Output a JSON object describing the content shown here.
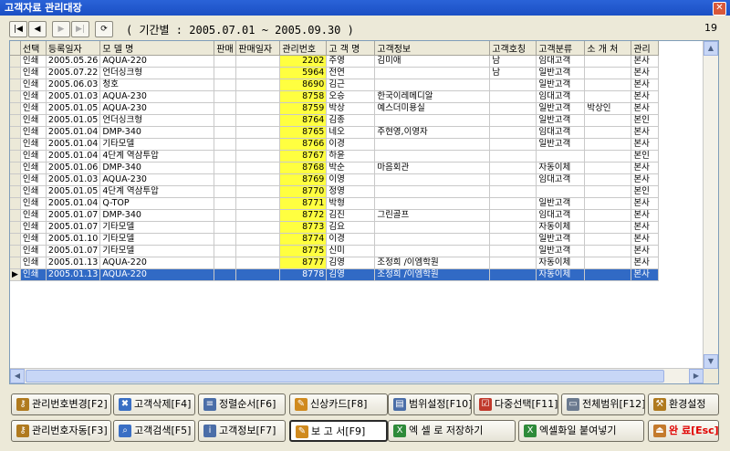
{
  "window": {
    "title": "고객자료 관리대장",
    "close_glyph": "✕"
  },
  "toolbar": {
    "nav": [
      "|◀",
      "◀",
      "▶",
      "▶|",
      "⟳"
    ],
    "period": "( 기간별 : 2005.07.01 ~ 2005.09.30 )",
    "count": "19"
  },
  "table": {
    "columns": [
      "선택",
      "등록일자",
      "모 델 명",
      "판매",
      "판매일자",
      "관리번호",
      "고 객 명",
      "고객정보",
      "고객호칭",
      "고객분류",
      "소 개 처",
      "관리"
    ],
    "rows": [
      [
        "인쇄",
        "2005.05.26",
        "AQUA-220",
        "",
        "",
        "2202",
        "주영",
        "김미애",
        "남",
        "임대고객",
        "",
        "본사"
      ],
      [
        "인쇄",
        "2005.07.22",
        "언더싱크형",
        "",
        "",
        "5964",
        "전연",
        "",
        "남",
        "일반고객",
        "",
        "본사"
      ],
      [
        "인쇄",
        "2005.06.03",
        "청호",
        "",
        "",
        "8690",
        "김근",
        "",
        "",
        "일반고객",
        "",
        "본사"
      ],
      [
        "인쇄",
        "2005.01.03",
        "AQUA-230",
        "",
        "",
        "8758",
        "오승",
        "한국이레메디알",
        "",
        "임대고객",
        "",
        "본사"
      ],
      [
        "인쇄",
        "2005.01.05",
        "AQUA-230",
        "",
        "",
        "8759",
        "박상",
        "예스더미용실",
        "",
        "일반고객",
        "박상인",
        "본사"
      ],
      [
        "인쇄",
        "2005.01.05",
        "언더싱크형",
        "",
        "",
        "8764",
        "김종",
        "",
        "",
        "일반고객",
        "",
        "본인"
      ],
      [
        "인쇄",
        "2005.01.04",
        "DMP-340",
        "",
        "",
        "8765",
        "네오",
        "주현영,이영자",
        "",
        "임대고객",
        "",
        "본사"
      ],
      [
        "인쇄",
        "2005.01.04",
        "기타모델",
        "",
        "",
        "8766",
        "이경",
        "",
        "",
        "일반고객",
        "",
        "본사"
      ],
      [
        "인쇄",
        "2005.01.04",
        "4단계 역삼투압",
        "",
        "",
        "8767",
        "하윤",
        "",
        "",
        "",
        "",
        "본인"
      ],
      [
        "인쇄",
        "2005.01.06",
        "DMP-340",
        "",
        "",
        "8768",
        "박순",
        "마음회관",
        "",
        "자동이체",
        "",
        "본사"
      ],
      [
        "인쇄",
        "2005.01.03",
        "AQUA-230",
        "",
        "",
        "8769",
        "이영",
        "",
        "",
        "임대고객",
        "",
        "본사"
      ],
      [
        "인쇄",
        "2005.01.05",
        "4단계 역삼투압",
        "",
        "",
        "8770",
        "정영",
        "",
        "",
        "",
        "",
        "본인"
      ],
      [
        "인쇄",
        "2005.01.04",
        "Q-TOP",
        "",
        "",
        "8771",
        "박형",
        "",
        "",
        "일반고객",
        "",
        "본사"
      ],
      [
        "인쇄",
        "2005.01.07",
        "DMP-340",
        "",
        "",
        "8772",
        "김진",
        "그린골프",
        "",
        "임대고객",
        "",
        "본사"
      ],
      [
        "인쇄",
        "2005.01.07",
        "기타모델",
        "",
        "",
        "8773",
        "김요",
        "",
        "",
        "자동이체",
        "",
        "본사"
      ],
      [
        "인쇄",
        "2005.01.10",
        "기타모델",
        "",
        "",
        "8774",
        "이경",
        "",
        "",
        "일반고객",
        "",
        "본사"
      ],
      [
        "인쇄",
        "2005.01.07",
        "기타모델",
        "",
        "",
        "8775",
        "신미",
        "",
        "",
        "일반고객",
        "",
        "본사"
      ],
      [
        "인쇄",
        "2005.01.13",
        "AQUA-220",
        "",
        "",
        "8777",
        "김영",
        "조정희 /이엠학원",
        "",
        "자동이체",
        "",
        "본사"
      ],
      [
        "인쇄",
        "2005.01.13",
        "AQUA-220",
        "",
        "",
        "8778",
        "김영",
        "조정희 /이엠학원",
        "",
        "자동이체",
        "",
        "본사"
      ]
    ],
    "selected_row": 18,
    "highlight_color": "#ffff40",
    "selection_color": "#316ac5"
  },
  "buttons": {
    "row1": [
      {
        "label": "관리번호변경[F2]",
        "icon": "key-icon",
        "color": "#b07a1e"
      },
      {
        "label": "고객삭제[F4]",
        "icon": "delete-person-icon",
        "color": "#3a6fc4"
      },
      {
        "label": "정렬순서[F6]",
        "icon": "sort-icon",
        "color": "#4b6ea8"
      },
      {
        "label": "신상카드[F8]",
        "icon": "card-icon",
        "color": "#d08a1e"
      },
      {
        "label": "범위설정[F10]",
        "icon": "range-icon",
        "color": "#4b6ea8"
      },
      {
        "label": "다중선택[F11]",
        "icon": "checklist-icon",
        "color": "#c0392b"
      },
      {
        "label": "전체범위[F12]",
        "icon": "document-icon",
        "color": "#6b7a8f"
      },
      {
        "label": "환경설정",
        "icon": "tools-icon",
        "color": "#b07a1e"
      }
    ],
    "row2": [
      {
        "label": "관리번호자동[F3]",
        "icon": "key-icon",
        "color": "#b07a1e"
      },
      {
        "label": "고객검색[F5]",
        "icon": "search-person-icon",
        "color": "#3a6fc4"
      },
      {
        "label": "고객정보[F7]",
        "icon": "info-icon",
        "color": "#4b6ea8"
      },
      {
        "label": "보 고 서[F9]",
        "icon": "report-icon",
        "color": "#d08a1e"
      },
      {
        "label": "엑 셀 로 저장하기",
        "icon": "excel-export-icon",
        "color": "#2e8b3a"
      },
      {
        "label": "엑셀화일 붙여넣기",
        "icon": "excel-import-icon",
        "color": "#2e8b3a"
      },
      {
        "label": "완 료[Esc]",
        "icon": "exit-door-icon",
        "color": "#c47a2c"
      }
    ]
  }
}
